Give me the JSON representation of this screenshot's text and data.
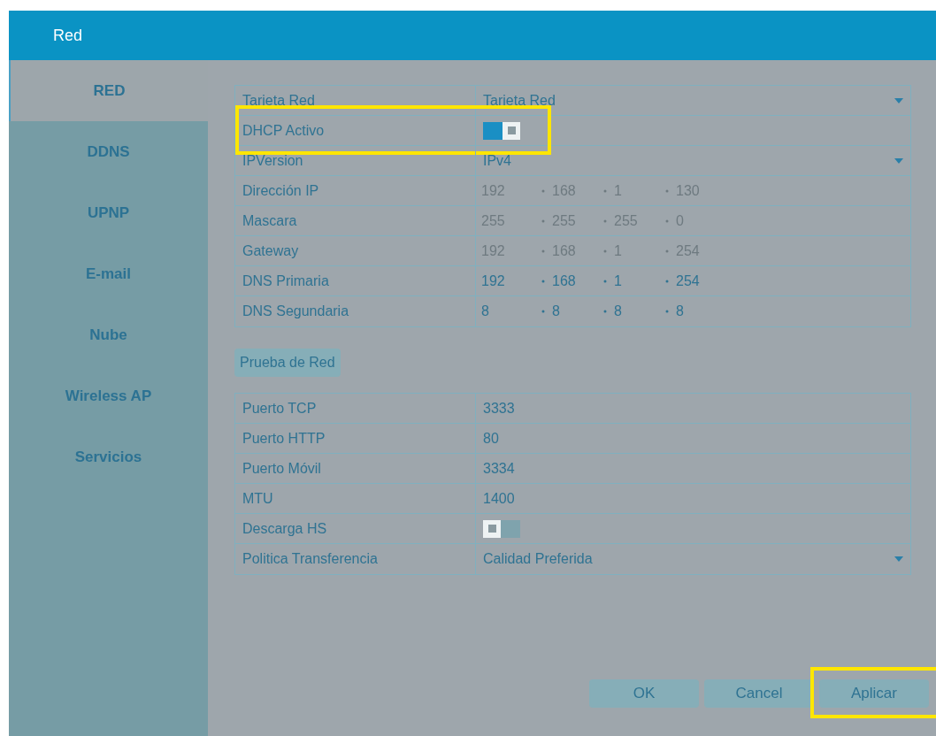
{
  "window": {
    "title": "Red"
  },
  "sidebar": {
    "items": [
      {
        "label": "RED",
        "selected": true
      },
      {
        "label": "DDNS",
        "selected": false
      },
      {
        "label": "UPNP",
        "selected": false
      },
      {
        "label": "E-mail",
        "selected": false
      },
      {
        "label": "Nube",
        "selected": false
      },
      {
        "label": "Wireless AP",
        "selected": false
      },
      {
        "label": "Servicios",
        "selected": false
      }
    ]
  },
  "network_table": [
    {
      "kind": "select",
      "label": "Tarjeta Red",
      "value": "Tarjeta Red",
      "highlighted": false
    },
    {
      "kind": "toggle",
      "label": "DHCP Activo",
      "on": true,
      "highlighted": true
    },
    {
      "kind": "select",
      "label": "IPVersion",
      "value": "IPv4",
      "highlighted": false
    },
    {
      "kind": "ip",
      "label": "Dirección IP",
      "segments": [
        "192",
        "168",
        "1",
        "130"
      ],
      "disabled": true,
      "highlighted": false
    },
    {
      "kind": "ip",
      "label": "Mascara",
      "segments": [
        "255",
        "255",
        "255",
        "0"
      ],
      "disabled": true,
      "highlighted": false
    },
    {
      "kind": "ip",
      "label": "Gateway",
      "segments": [
        "192",
        "168",
        "1",
        "254"
      ],
      "disabled": true,
      "highlighted": false
    },
    {
      "kind": "ip",
      "label": "DNS Primaria",
      "segments": [
        "192",
        "168",
        "1",
        "254"
      ],
      "disabled": false,
      "highlighted": false
    },
    {
      "kind": "ip",
      "label": "DNS Segundaria",
      "segments": [
        "8",
        "8",
        "8",
        "8"
      ],
      "disabled": false,
      "highlighted": false
    }
  ],
  "test_button": "Prueba de Red",
  "ports_table": [
    {
      "kind": "text",
      "label": "Puerto TCP",
      "value": "3333",
      "highlighted": false
    },
    {
      "kind": "text",
      "label": "Puerto HTTP",
      "value": "80",
      "highlighted": false
    },
    {
      "kind": "text",
      "label": "Puerto Móvil",
      "value": "3334",
      "highlighted": false
    },
    {
      "kind": "text",
      "label": "MTU",
      "value": "1400",
      "highlighted": false
    },
    {
      "kind": "toggle",
      "label": "Descarga HS",
      "on": false,
      "highlighted": false
    },
    {
      "kind": "select",
      "label": "Politica Transferencia",
      "value": "Calidad Preferida",
      "highlighted": false
    }
  ],
  "buttons": [
    {
      "label": "OK",
      "highlighted": false
    },
    {
      "label": "Cancel",
      "highlighted": false
    },
    {
      "label": "Aplicar",
      "highlighted": true
    }
  ]
}
